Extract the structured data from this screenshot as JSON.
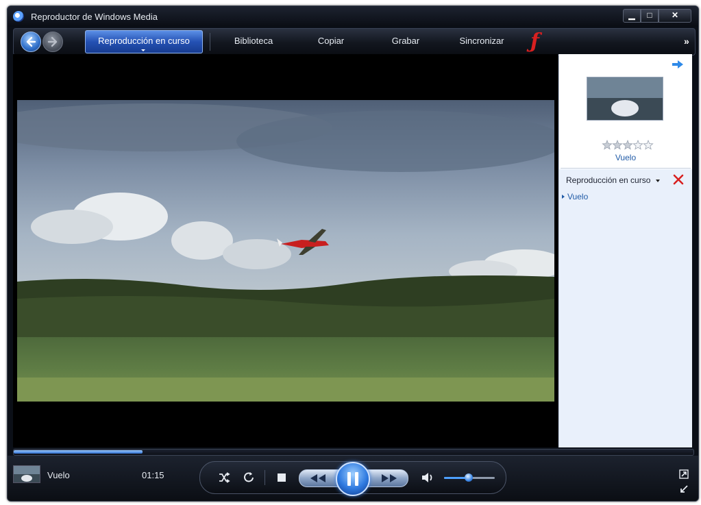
{
  "window": {
    "title": "Reproductor de Windows Media",
    "controls": [
      "minimize",
      "maximize",
      "close"
    ]
  },
  "nav": {
    "back_icon": "back-arrow-icon",
    "forward_icon": "forward-arrow-icon",
    "tabs": [
      {
        "label": "Reproducción en curso",
        "active": true
      },
      {
        "label": "Biblioteca"
      },
      {
        "label": "Copiar"
      },
      {
        "label": "Grabar"
      },
      {
        "label": "Sincronizar"
      }
    ],
    "more_label": "»"
  },
  "sidebar": {
    "arrow_icon": "right-arrow-icon",
    "media_title": "Vuelo",
    "rating": 3,
    "rating_max": 5,
    "playlist_header": "Reproducción en curso",
    "items": [
      "Vuelo"
    ]
  },
  "player": {
    "now_playing_title": "Vuelo",
    "elapsed": "01:15",
    "progress_fraction": 0.19,
    "volume_fraction": 0.48
  },
  "colors": {
    "accent": "#2f6fd1",
    "link": "#1f5aa6",
    "clear_icon": "#d82020"
  }
}
